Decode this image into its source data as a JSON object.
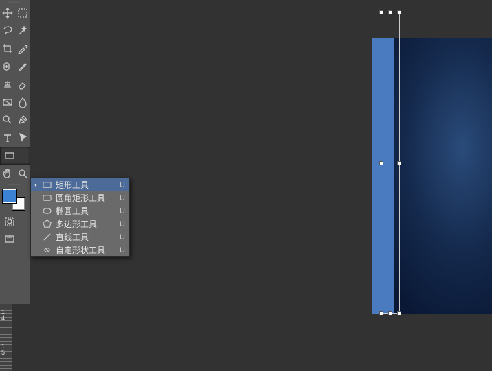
{
  "flyout": {
    "items": [
      {
        "label": "矩形工具",
        "shortcut": "U",
        "selected": true,
        "icon": "rect"
      },
      {
        "label": "圆角矩形工具",
        "shortcut": "U",
        "selected": false,
        "icon": "roundrect"
      },
      {
        "label": "椭圆工具",
        "shortcut": "U",
        "selected": false,
        "icon": "ellipse"
      },
      {
        "label": "多边形工具",
        "shortcut": "U",
        "selected": false,
        "icon": "polygon"
      },
      {
        "label": "直线工具",
        "shortcut": "U",
        "selected": false,
        "icon": "line"
      },
      {
        "label": "自定形状工具",
        "shortcut": "U",
        "selected": false,
        "icon": "custom"
      }
    ]
  },
  "ruler": {
    "label14": "1\n4",
    "label15": "1\n5"
  },
  "colors": {
    "foreground": "#3b82d4",
    "background": "#ffffff"
  },
  "selected_tool": "rectangle-tool"
}
